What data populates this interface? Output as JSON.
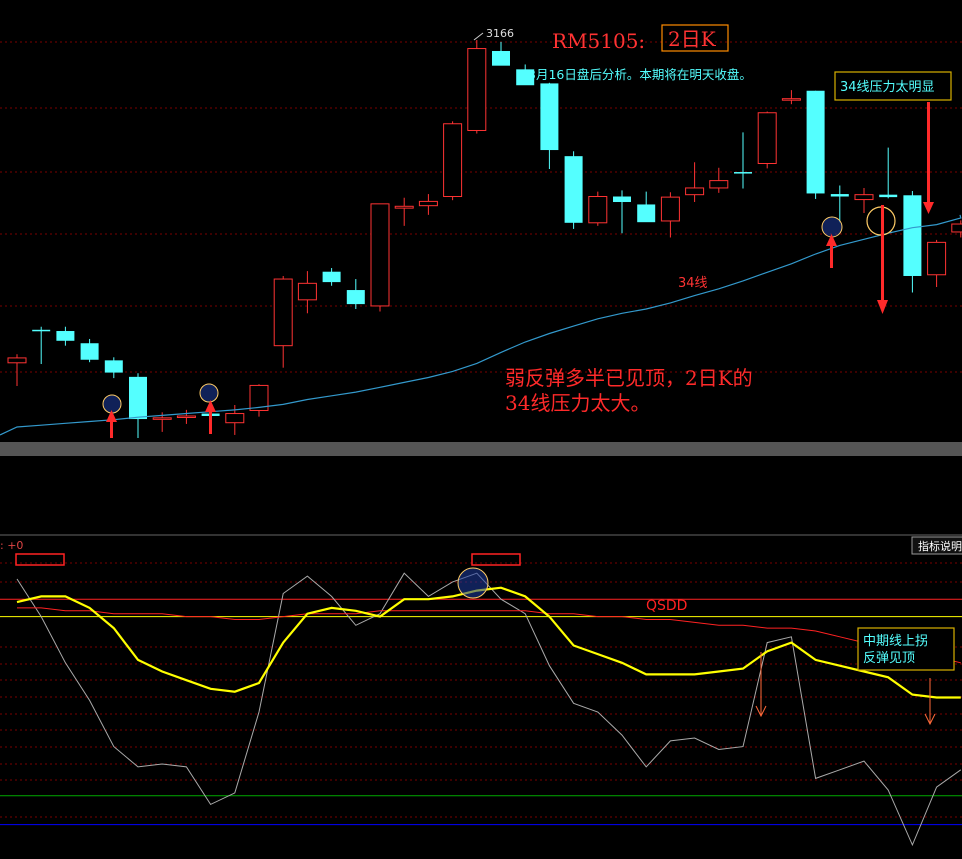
{
  "header": {
    "symbol": "RM5105:",
    "period": "2日K",
    "subtitle": "3月16日盘后分析。本期将在明天收盘。"
  },
  "annotations": {
    "high_label": "3166",
    "ma_label": "34线",
    "pressure_box": "34线压力太明显",
    "main_comment_line1": "弱反弹多半已见顶，2日K的",
    "main_comment_line2": "34线压力太大。",
    "indicator_prefix": ": +0",
    "indicator_help_button": "指标说明",
    "indicator_name": "QSDD",
    "indicator_box_line1": "中期线上拐",
    "indicator_box_line2": "反弹见顶"
  },
  "colors": {
    "background": "#000000",
    "up_candle": "#ff3333",
    "down_candle": "#54ffff",
    "ma34": "#3399cc",
    "separator": "#555555",
    "indicator_yellow": "#ffff00",
    "indicator_red": "#ff2222",
    "indicator_white": "#aaaaaa",
    "ref_green": "#00aa00",
    "ref_blue": "#0000ff",
    "annotation_red": "#ff2a2a",
    "annotation_cyan": "#54ffff"
  },
  "chart_data": [
    {
      "type": "candlestick",
      "max_label": "3166",
      "ma_series_name": "34线",
      "candles": [
        {
          "o": 2638,
          "h": 2652,
          "l": 2600,
          "c": 2646
        },
        {
          "o": 2692,
          "h": 2697,
          "l": 2636,
          "c": 2690
        },
        {
          "o": 2690,
          "h": 2697,
          "l": 2666,
          "c": 2674
        },
        {
          "o": 2670,
          "h": 2677,
          "l": 2639,
          "c": 2643
        },
        {
          "o": 2642,
          "h": 2647,
          "l": 2613,
          "c": 2622
        },
        {
          "o": 2615,
          "h": 2621,
          "l": 2515,
          "c": 2546
        },
        {
          "o": 2546,
          "h": 2557,
          "l": 2525,
          "c": 2548
        },
        {
          "o": 2549,
          "h": 2561,
          "l": 2538,
          "c": 2551
        },
        {
          "o": 2555,
          "h": 2563,
          "l": 2538,
          "c": 2551
        },
        {
          "o": 2540,
          "h": 2569,
          "l": 2520,
          "c": 2555
        },
        {
          "o": 2560,
          "h": 2603,
          "l": 2550,
          "c": 2601
        },
        {
          "o": 2666,
          "h": 2780,
          "l": 2630,
          "c": 2775
        },
        {
          "o": 2741,
          "h": 2788,
          "l": 2719,
          "c": 2768
        },
        {
          "o": 2787,
          "h": 2793,
          "l": 2764,
          "c": 2770
        },
        {
          "o": 2757,
          "h": 2775,
          "l": 2726,
          "c": 2734
        },
        {
          "o": 2731,
          "h": 2897,
          "l": 2722,
          "c": 2898
        },
        {
          "o": 2891,
          "h": 2908,
          "l": 2862,
          "c": 2894
        },
        {
          "o": 2895,
          "h": 2914,
          "l": 2880,
          "c": 2902
        },
        {
          "o": 2910,
          "h": 3033,
          "l": 2904,
          "c": 3029
        },
        {
          "o": 3018,
          "h": 3166,
          "l": 3013,
          "c": 3152
        },
        {
          "o": 3148,
          "h": 3163,
          "l": 3125,
          "c": 3124
        },
        {
          "o": 3118,
          "h": 3126,
          "l": 3094,
          "c": 3092
        },
        {
          "o": 3095,
          "h": 3096,
          "l": 2955,
          "c": 2986
        },
        {
          "o": 2976,
          "h": 2984,
          "l": 2857,
          "c": 2867
        },
        {
          "o": 2867,
          "h": 2918,
          "l": 2862,
          "c": 2910
        },
        {
          "o": 2910,
          "h": 2920,
          "l": 2850,
          "c": 2901
        },
        {
          "o": 2897,
          "h": 2918,
          "l": 2869,
          "c": 2868
        },
        {
          "o": 2870,
          "h": 2917,
          "l": 2843,
          "c": 2909
        },
        {
          "o": 2913,
          "h": 2966,
          "l": 2901,
          "c": 2924
        },
        {
          "o": 2924,
          "h": 2957,
          "l": 2916,
          "c": 2936
        },
        {
          "o": 2950,
          "h": 3015,
          "l": 2923,
          "c": 2948
        },
        {
          "o": 2964,
          "h": 3049,
          "l": 2956,
          "c": 3047
        },
        {
          "o": 3068,
          "h": 3084,
          "l": 3061,
          "c": 3070
        },
        {
          "o": 3083,
          "h": 3083,
          "l": 2906,
          "c": 2915
        },
        {
          "o": 2914,
          "h": 2928,
          "l": 2868,
          "c": 2910
        },
        {
          "o": 2905,
          "h": 2924,
          "l": 2883,
          "c": 2913
        },
        {
          "o": 2913,
          "h": 2990,
          "l": 2907,
          "c": 2909
        },
        {
          "o": 2912,
          "h": 2919,
          "l": 2753,
          "c": 2780
        },
        {
          "o": 2782,
          "h": 2839,
          "l": 2762,
          "c": 2835
        },
        {
          "o": 2852,
          "h": 2871,
          "l": 2843,
          "c": 2865
        }
      ],
      "ma34": [
        2533,
        2536,
        2539,
        2542,
        2545,
        2549,
        2552,
        2555,
        2558,
        2561,
        2565,
        2570,
        2578,
        2584,
        2590,
        2598,
        2606,
        2614,
        2624,
        2637,
        2655,
        2672,
        2686,
        2698,
        2710,
        2719,
        2726,
        2736,
        2748,
        2759,
        2772,
        2786,
        2800,
        2816,
        2830,
        2840,
        2850,
        2859,
        2864,
        2875
      ]
    },
    {
      "type": "line",
      "name": "QSDD",
      "ylim": [
        0,
        100
      ],
      "reference_lines": [
        84,
        78,
        16,
        6
      ],
      "series": [
        {
          "color": "#ffff00",
          "values": [
            83,
            85,
            85,
            81,
            74,
            63,
            59,
            56,
            53,
            52,
            55,
            69,
            79,
            81,
            80,
            78,
            84,
            84,
            85,
            87,
            88,
            85,
            78,
            68,
            65,
            62,
            58,
            58,
            58,
            59,
            60,
            66,
            69,
            63,
            61,
            59,
            57,
            51,
            50,
            50
          ]
        },
        {
          "color": "#ff2222",
          "values": [
            81,
            81,
            80,
            80,
            79,
            79,
            79,
            78,
            78,
            77,
            77,
            78,
            79,
            79,
            79,
            80,
            80,
            80,
            80,
            80,
            80,
            80,
            79,
            79,
            78,
            78,
            77,
            77,
            76,
            75,
            75,
            74,
            74,
            73,
            71,
            69,
            67,
            66,
            64,
            62
          ]
        },
        {
          "color": "#aaaaaa",
          "values": [
            91,
            78,
            62,
            49,
            33,
            26,
            27,
            26,
            13,
            17,
            45,
            86,
            92,
            85,
            75,
            79,
            93,
            85,
            90,
            93,
            84,
            79,
            61,
            48,
            45,
            37,
            26,
            35,
            36,
            32,
            33,
            69,
            71,
            22,
            25,
            28,
            18,
            -1,
            19,
            25
          ]
        }
      ]
    }
  ]
}
